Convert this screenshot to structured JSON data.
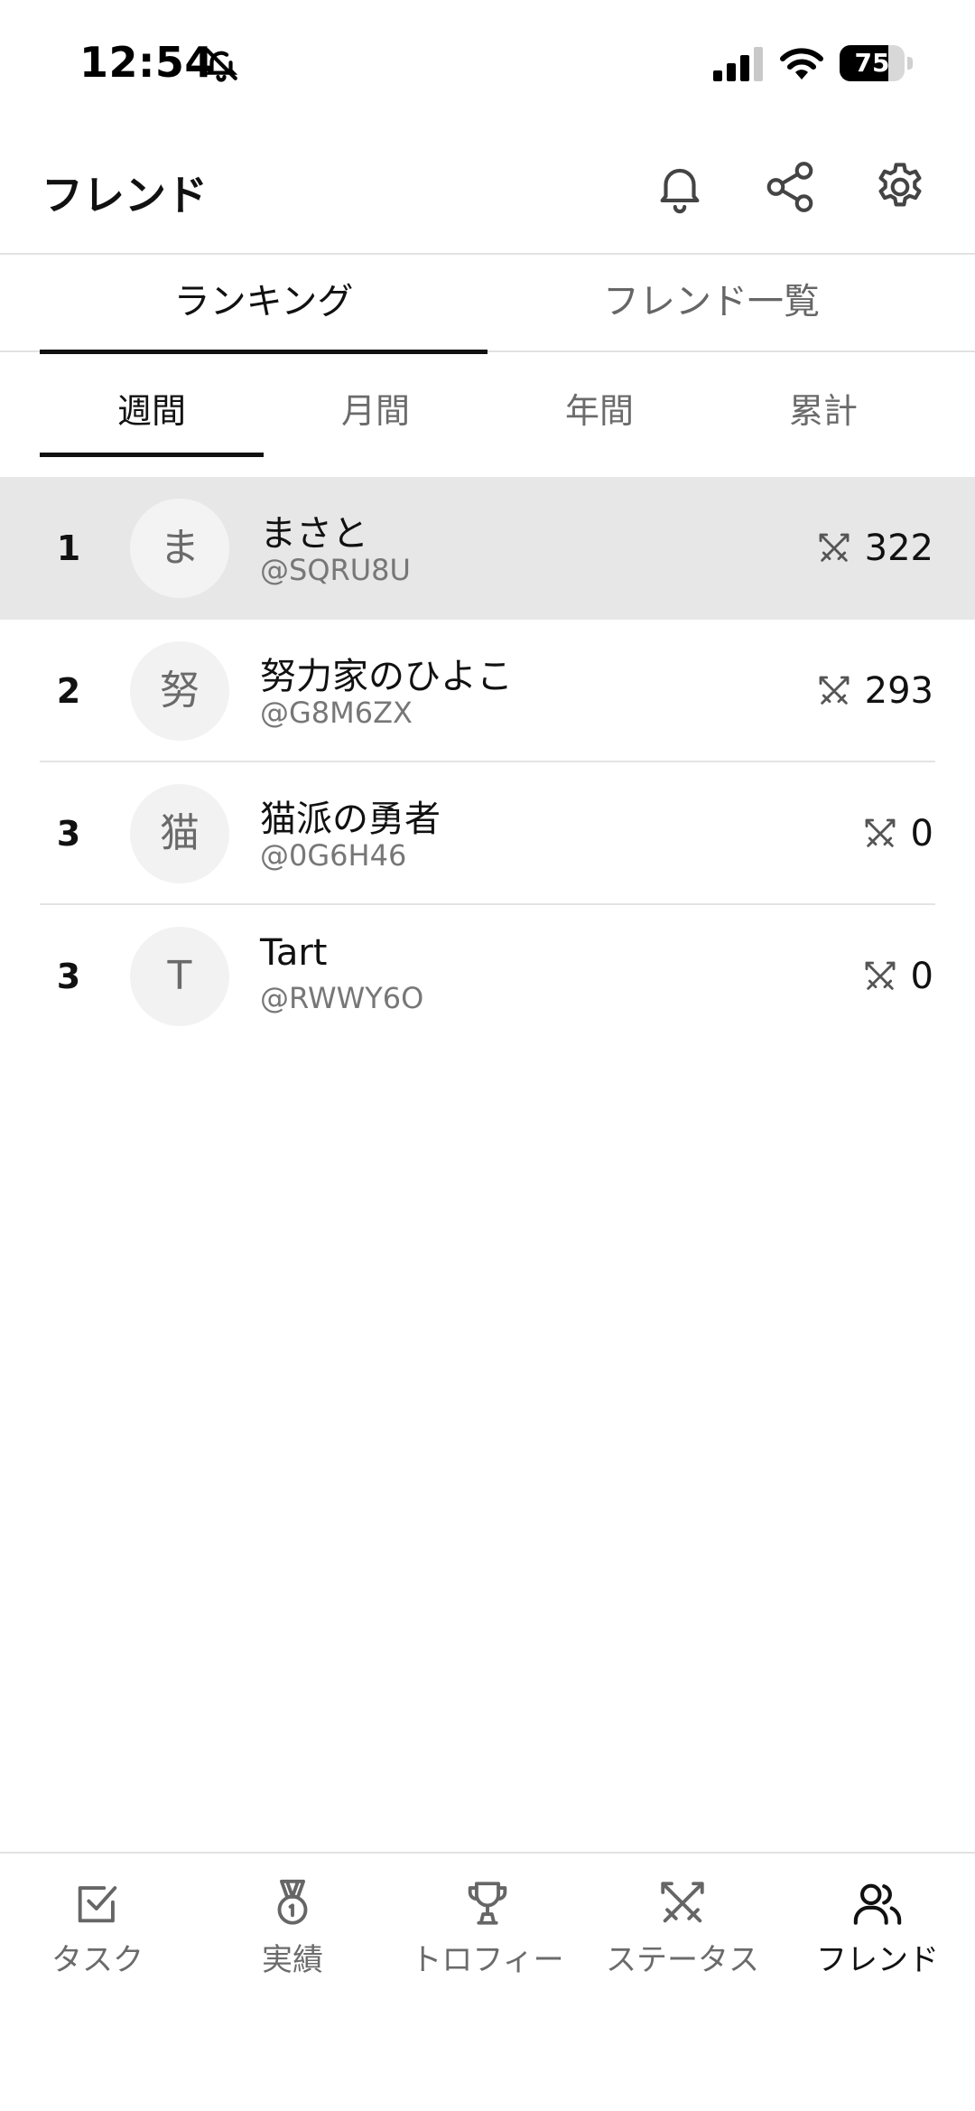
{
  "status_bar": {
    "time": "12:54",
    "battery": "75",
    "battery_level": 0.75
  },
  "header": {
    "title": "フレンド",
    "icons": [
      "bell-icon",
      "share-icon",
      "gear-icon"
    ]
  },
  "main_tabs": [
    {
      "label": "ランキング",
      "active": true
    },
    {
      "label": "フレンド一覧",
      "active": false
    }
  ],
  "period_tabs": [
    {
      "label": "週間",
      "active": true
    },
    {
      "label": "月間",
      "active": false
    },
    {
      "label": "年間",
      "active": false
    },
    {
      "label": "累計",
      "active": false
    }
  ],
  "ranking": [
    {
      "rank": "1",
      "avatar": "ま",
      "name": "まさと",
      "handle": "@SQRU8U",
      "score": "322",
      "highlight": true
    },
    {
      "rank": "2",
      "avatar": "努",
      "name": "努力家のひよこ",
      "handle": "@G8M6ZX",
      "score": "293",
      "highlight": false
    },
    {
      "rank": "3",
      "avatar": "猫",
      "name": "猫派の勇者",
      "handle": "@0G6H46",
      "score": "0",
      "highlight": false
    },
    {
      "rank": "3",
      "avatar": "T",
      "name": "Tart",
      "handle": "@RWWY6O",
      "score": "0",
      "highlight": false
    }
  ],
  "bottom_nav": [
    {
      "label": "タスク",
      "icon": "checkbox-icon",
      "active": false
    },
    {
      "label": "実績",
      "icon": "medal-icon",
      "active": false
    },
    {
      "label": "トロフィー",
      "icon": "trophy-icon",
      "active": false
    },
    {
      "label": "ステータス",
      "icon": "crossed-swords-icon",
      "active": false
    },
    {
      "label": "フレンド",
      "icon": "users-icon",
      "active": true
    }
  ],
  "colors": {
    "text": "#111111",
    "muted": "#6b6b6b",
    "highlight_row": "#e7e7e7",
    "divider": "#e2e2e2"
  }
}
